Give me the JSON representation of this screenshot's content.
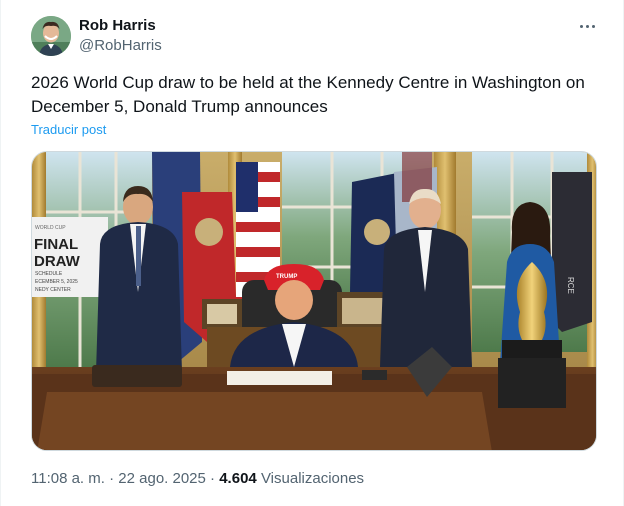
{
  "author": {
    "name": "Rob Harris",
    "handle": "@RobHarris"
  },
  "tweet": {
    "text": "2026 World Cup draw to be held at the Kennedy Centre in Washington on December 5, Donald Trump announces",
    "translate_label": "Traducir post"
  },
  "media": {
    "sign_text_top": "WORLD CUP",
    "sign_title_1": "FINAL",
    "sign_title_2": "DRAW",
    "sign_line_1": "SCHEDULE",
    "sign_line_2": "ECEMBER 5, 2025",
    "sign_line_3": "NEDY CENTER",
    "hat_text": "TRUMP",
    "side_text": "RCE"
  },
  "meta": {
    "time": "11:08 a. m.",
    "date": "22 ago. 2025",
    "separator": "·",
    "views_count": "4.604",
    "views_label": "Visualizaciones"
  }
}
